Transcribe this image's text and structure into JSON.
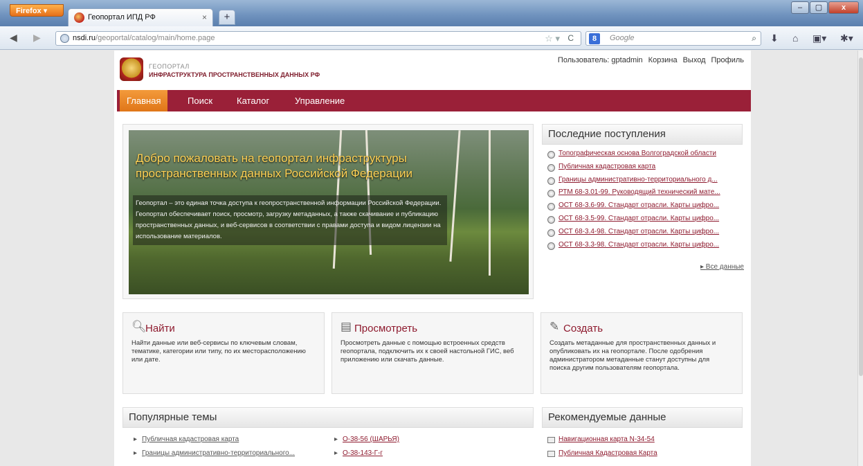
{
  "browser": {
    "menu_button": "Firefox",
    "tab_title": "Геопортал ИПД РФ",
    "tab_close": "×",
    "new_tab": "+",
    "url_domain": "nsdi.ru",
    "url_path": "/geoportal/catalog/main/home.page",
    "search_engine": "Google",
    "search_engine_letter": "8",
    "window_minimize": "–",
    "window_maximize": "▢",
    "window_close": "x"
  },
  "header": {
    "logo_small": "ГЕОПОРТАЛ",
    "logo_big": "ИНФРАСТРУКТУРА ПРОСТРАНСТВЕННЫХ ДАННЫХ РФ",
    "user": "Пользователь: gptadmin",
    "cart": "Корзина",
    "logout": "Выход",
    "profile": "Профиль"
  },
  "menu": {
    "items": [
      "Главная",
      "Поиск",
      "Каталог",
      "Управление"
    ]
  },
  "hero": {
    "title": "Добро пожаловать на геопортал инфраструктуры пространственных данных Российской Федерации",
    "text": "Геопортал – это единая точка доступа к геопространственной информации Российской Федерации. Геопортал обеспечивает поиск, просмотр, загрузку метаданных, а также скачивание и публикацию пространственных данных, и веб-сервисов в соответствии с правами доступа и видом лицензии на использование материалов."
  },
  "recent": {
    "title": "Последние поступления",
    "items": [
      "Топографическая основа Волгоградской области",
      "Публичная кадастровая карта",
      "Границы административно-территориального д...",
      "РТМ 68-3.01-99. Руководящий технический мате...",
      "ОСТ 68-3.6-99. Стандарт отрасли. Карты цифро...",
      "ОСТ 68-3.5-99. Стандарт отрасли. Карты цифро...",
      "ОСТ 68-3.4-98. Стандарт отрасли. Карты цифро...",
      "ОСТ 68-3.3-98. Стандарт отрасли. Карты цифро..."
    ],
    "all_link": "Все данные"
  },
  "cards": {
    "find": {
      "title": "Найти",
      "text": "Найти данные или веб-сервисы по ключевым словам, тематике, категории или типу, по их месторасположению или дате."
    },
    "view": {
      "title": "Просмотреть",
      "text": "Просмотреть данные с помощью встроенных средств геопортала, подключить их к своей настольной ГИС, веб приложению или скачать данные."
    },
    "create": {
      "title": "Создать",
      "text": "Создать метаданные для пространственных данных и опубликовать их на геопортале. После одобрения администратором метаданные станут доступны для поиска другим пользователям геопортала."
    }
  },
  "popular": {
    "title": "Популярные темы",
    "col1": [
      "Публичная кадастровая карта",
      "Границы административно-территориального..."
    ],
    "col2": [
      "О-38-56 (ШАРЬЯ)",
      "О-38-143-Г-г"
    ]
  },
  "recommended": {
    "title": "Рекомендуемые данные",
    "items": [
      "Навигационная карта N-34-54",
      "Публичная Кадастровая Карта"
    ]
  }
}
